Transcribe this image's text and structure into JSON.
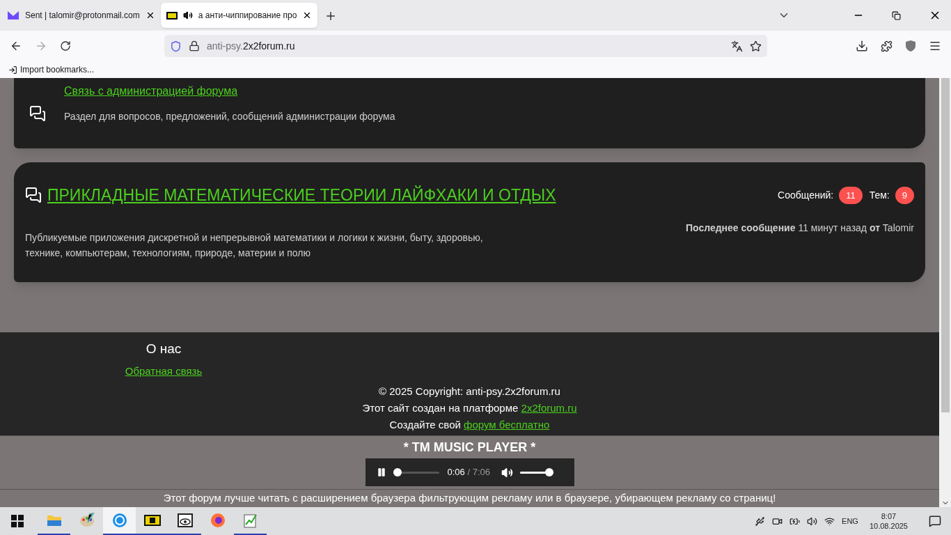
{
  "browser": {
    "tabs": [
      {
        "title": "Sent | talomir@protonmail.com",
        "selected": false,
        "audio": false
      },
      {
        "title": "а анти-чиппирование про",
        "selected": true,
        "audio": true
      }
    ],
    "url": {
      "host_prefix": "anti-psy.",
      "host": "2x2forum.ru"
    },
    "bookmarks": [
      "Import bookmarks..."
    ]
  },
  "forums": [
    {
      "title": "Связь с администрацией форума",
      "description": "Раздел для вопросов, предложений, сообщений администрации форума",
      "kind": "partial"
    },
    {
      "title": "ПРИКЛАДНЫЕ МАТЕМАТИЧЕСКИЕ ТЕОРИИ ЛАЙФХАКИ И ОТДЫХ",
      "description": "Публикуемые приложения дискретной и непрерывной математики и логики к жизни, быту, здоровью, технике, компьютерам, технологиям, природе, материи и полю",
      "kind": "full",
      "posts_label": "Сообщений:",
      "posts": "11",
      "topics_label": "Тем:",
      "topics": "9",
      "last_post": "**Последнее сообщение** 11 минут назад **от** Talomir"
    }
  ],
  "footer": {
    "heading": "О нас",
    "feedback_link": "Обратная связь",
    "copyright": "© 2025 Copyright: anti-psy.2x2forum.ru",
    "lines": [
      {
        "text": "Этот сайт создан на платформе",
        "link": "2x2forum.ru"
      },
      {
        "text": "Создайте свой",
        "link": "форум бесплатно"
      }
    ]
  },
  "player": {
    "title": "* TM MUSIC PLAYER *",
    "playing": true,
    "current": "0:06",
    "duration": "/ 7:06",
    "progress": {
      "level": 0.015
    },
    "volume": {
      "level": 1
    }
  },
  "banner": "Этот форум лучше читать с расширением браузера фильтрующим рекламу или в браузере, убирающем рекламу со страниц!",
  "taskbar": {
    "apps": [
      {
        "kind": "explorer",
        "selected": false,
        "running": true
      },
      {
        "kind": "paint",
        "selected": false,
        "running": false
      },
      {
        "kind": "browser-circle",
        "selected": true,
        "running": true
      },
      {
        "kind": "yellow-app",
        "selected": false,
        "running": true
      },
      {
        "kind": "eye-app",
        "selected": false,
        "running": true
      },
      {
        "kind": "firefox",
        "selected": false,
        "running": false
      },
      {
        "kind": "editor",
        "selected": false,
        "running": true
      }
    ],
    "language": "ENG",
    "time": "8:07",
    "date": "10.08.2025"
  }
}
